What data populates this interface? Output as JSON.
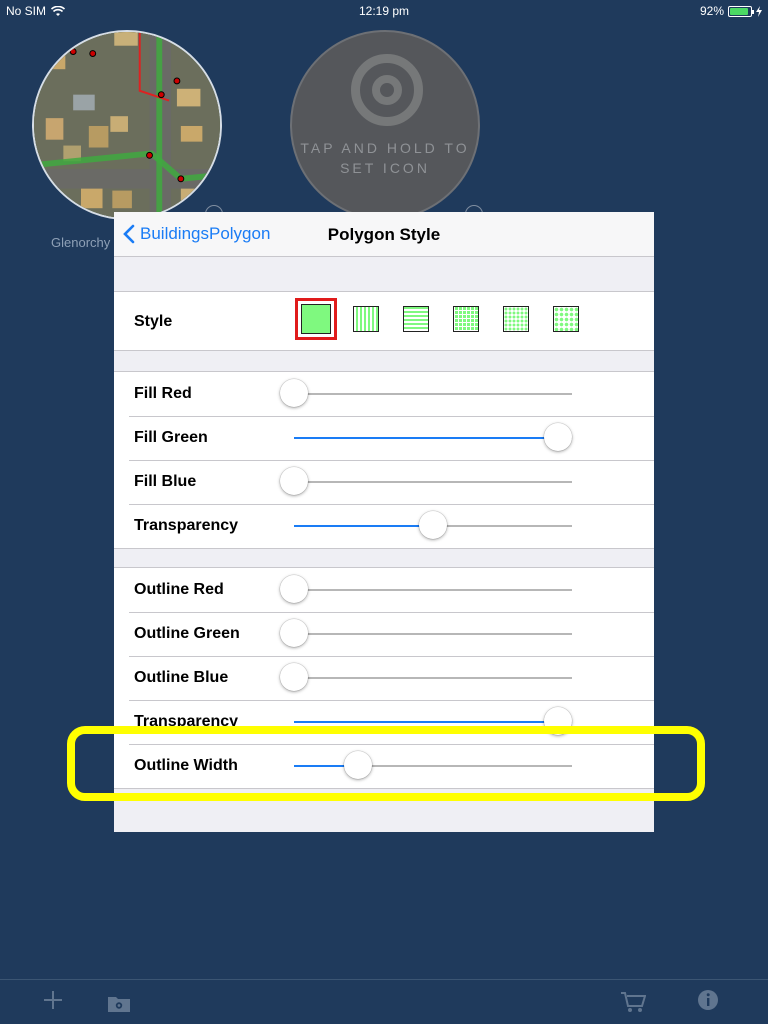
{
  "status_bar": {
    "carrier": "No SIM",
    "time": "12:19 pm",
    "battery": "92%"
  },
  "background": {
    "map_caption": "Glenorchy",
    "icon_hint": "TAP AND HOLD TO SET ICON"
  },
  "popover": {
    "back_label": "BuildingsPolygon",
    "title": "Polygon Style",
    "style_label": "Style",
    "style_options": [
      "solid",
      "vertical-lines",
      "horizontal-lines",
      "grid",
      "dots",
      "dense-dots"
    ],
    "selected_style": "solid",
    "fill_group": [
      {
        "label": "Fill Red",
        "value": 0.0
      },
      {
        "label": "Fill Green",
        "value": 0.95
      },
      {
        "label": "Fill Blue",
        "value": 0.0
      },
      {
        "label": "Transparency",
        "value": 0.5
      }
    ],
    "outline_group": [
      {
        "label": "Outline Red",
        "value": 0.0
      },
      {
        "label": "Outline Green",
        "value": 0.0
      },
      {
        "label": "Outline Blue",
        "value": 0.0
      },
      {
        "label": "Transparency",
        "value": 0.95
      },
      {
        "label": "Outline Width",
        "value": 0.23
      }
    ]
  },
  "highlight": {
    "color": "#ffff00",
    "target": "Outline Width"
  },
  "colors": {
    "background": "#1f3a5c",
    "accent": "#1a7cf5",
    "swatch_fill": "#7ff97f",
    "selected_border": "#e01b1b"
  },
  "toolbar": {
    "icons": [
      "plus-icon",
      "folder-settings-icon",
      "cart-icon",
      "info-icon"
    ]
  }
}
